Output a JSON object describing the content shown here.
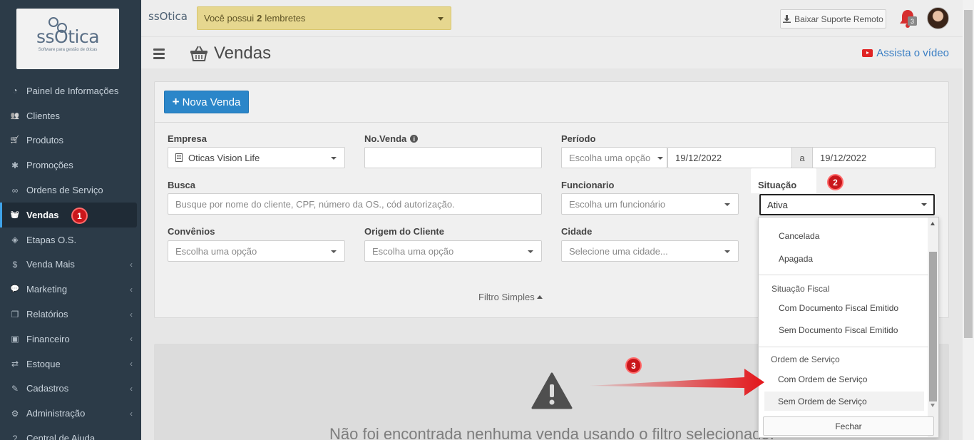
{
  "sidebar": {
    "logo_text": "ssOtica",
    "logo_sub": "Software para gestão de óticas",
    "items": [
      {
        "label": "Painel de Informações",
        "icon": "dashboard-icon",
        "chev": false
      },
      {
        "label": "Clientes",
        "icon": "users-icon",
        "chev": false
      },
      {
        "label": "Produtos",
        "icon": "cart-icon",
        "chev": false
      },
      {
        "label": "Promoções",
        "icon": "asterisk-icon",
        "chev": false
      },
      {
        "label": "Ordens de Serviço",
        "icon": "glasses-icon",
        "chev": false
      },
      {
        "label": "Vendas",
        "icon": "basket-icon",
        "chev": false,
        "active": true
      },
      {
        "label": "Etapas O.S.",
        "icon": "tag-icon",
        "chev": false
      },
      {
        "label": "Venda Mais",
        "icon": "dollar-icon",
        "chev": true
      },
      {
        "label": "Marketing",
        "icon": "comments-icon",
        "chev": true
      },
      {
        "label": "Relatórios",
        "icon": "copy-icon",
        "chev": true
      },
      {
        "label": "Financeiro",
        "icon": "money-icon",
        "chev": true
      },
      {
        "label": "Estoque",
        "icon": "exchange-icon",
        "chev": true
      },
      {
        "label": "Cadastros",
        "icon": "edit-icon",
        "chev": true
      },
      {
        "label": "Administração",
        "icon": "cogs-icon",
        "chev": true
      },
      {
        "label": "Central de Ajuda",
        "icon": "question-icon",
        "chev": false
      }
    ]
  },
  "topbar": {
    "logo_text": "ssOtica",
    "reminder_prefix": "Você possui",
    "reminder_count": "2",
    "reminder_suffix": "lembretes",
    "support_label": "Baixar Suporte Remoto",
    "notification_count": "3"
  },
  "header": {
    "title": "Vendas",
    "watch_label": "Assista o vídeo"
  },
  "toolbar": {
    "new_sale_label": "Nova Venda"
  },
  "filters": {
    "empresa_label": "Empresa",
    "empresa_value": "Oticas Vision Life",
    "novenda_label": "No.Venda",
    "novenda_value": "",
    "periodo_label": "Período",
    "periodo_placeholder": "Escolha uma opção",
    "periodo_start": "19/12/2022",
    "periodo_sep": "a",
    "periodo_end": "19/12/2022",
    "busca_label": "Busca",
    "busca_placeholder": "Busque por nome do cliente, CPF, número da OS., cód autorização.",
    "funcionario_label": "Funcionario",
    "funcionario_placeholder": "Escolha um funcionário",
    "situacao_label": "Situação",
    "situacao_value": "Ativa",
    "convenios_label": "Convênios",
    "convenios_placeholder": "Escolha uma opção",
    "origem_label": "Origem do Cliente",
    "origem_placeholder": "Escolha uma opção",
    "cidade_label": "Cidade",
    "cidade_placeholder": "Selecione uma cidade...",
    "simple_filter_label": "Filtro Simples"
  },
  "dropdown": {
    "options_top": [
      "Cancelada",
      "Apagada"
    ],
    "group_fiscal": "Situação Fiscal",
    "options_fiscal": [
      "Com Documento Fiscal Emitido",
      "Sem Documento Fiscal Emitido"
    ],
    "group_os": "Ordem de Serviço",
    "options_os": [
      "Com Ordem de Serviço",
      "Sem Ordem de Serviço"
    ],
    "close_label": "Fechar"
  },
  "empty_state": {
    "message": "Não foi encontrada nenhuma venda usando o filtro selecionado."
  },
  "annotations": {
    "step1": "1",
    "step2": "2",
    "step3": "3"
  },
  "colors": {
    "sidebar_bg": "#2c3b48",
    "primary": "#2b86c9",
    "reminder_bg": "#e6d78f",
    "badge_red": "#c9161b",
    "arrow_red": "#e3171b"
  }
}
